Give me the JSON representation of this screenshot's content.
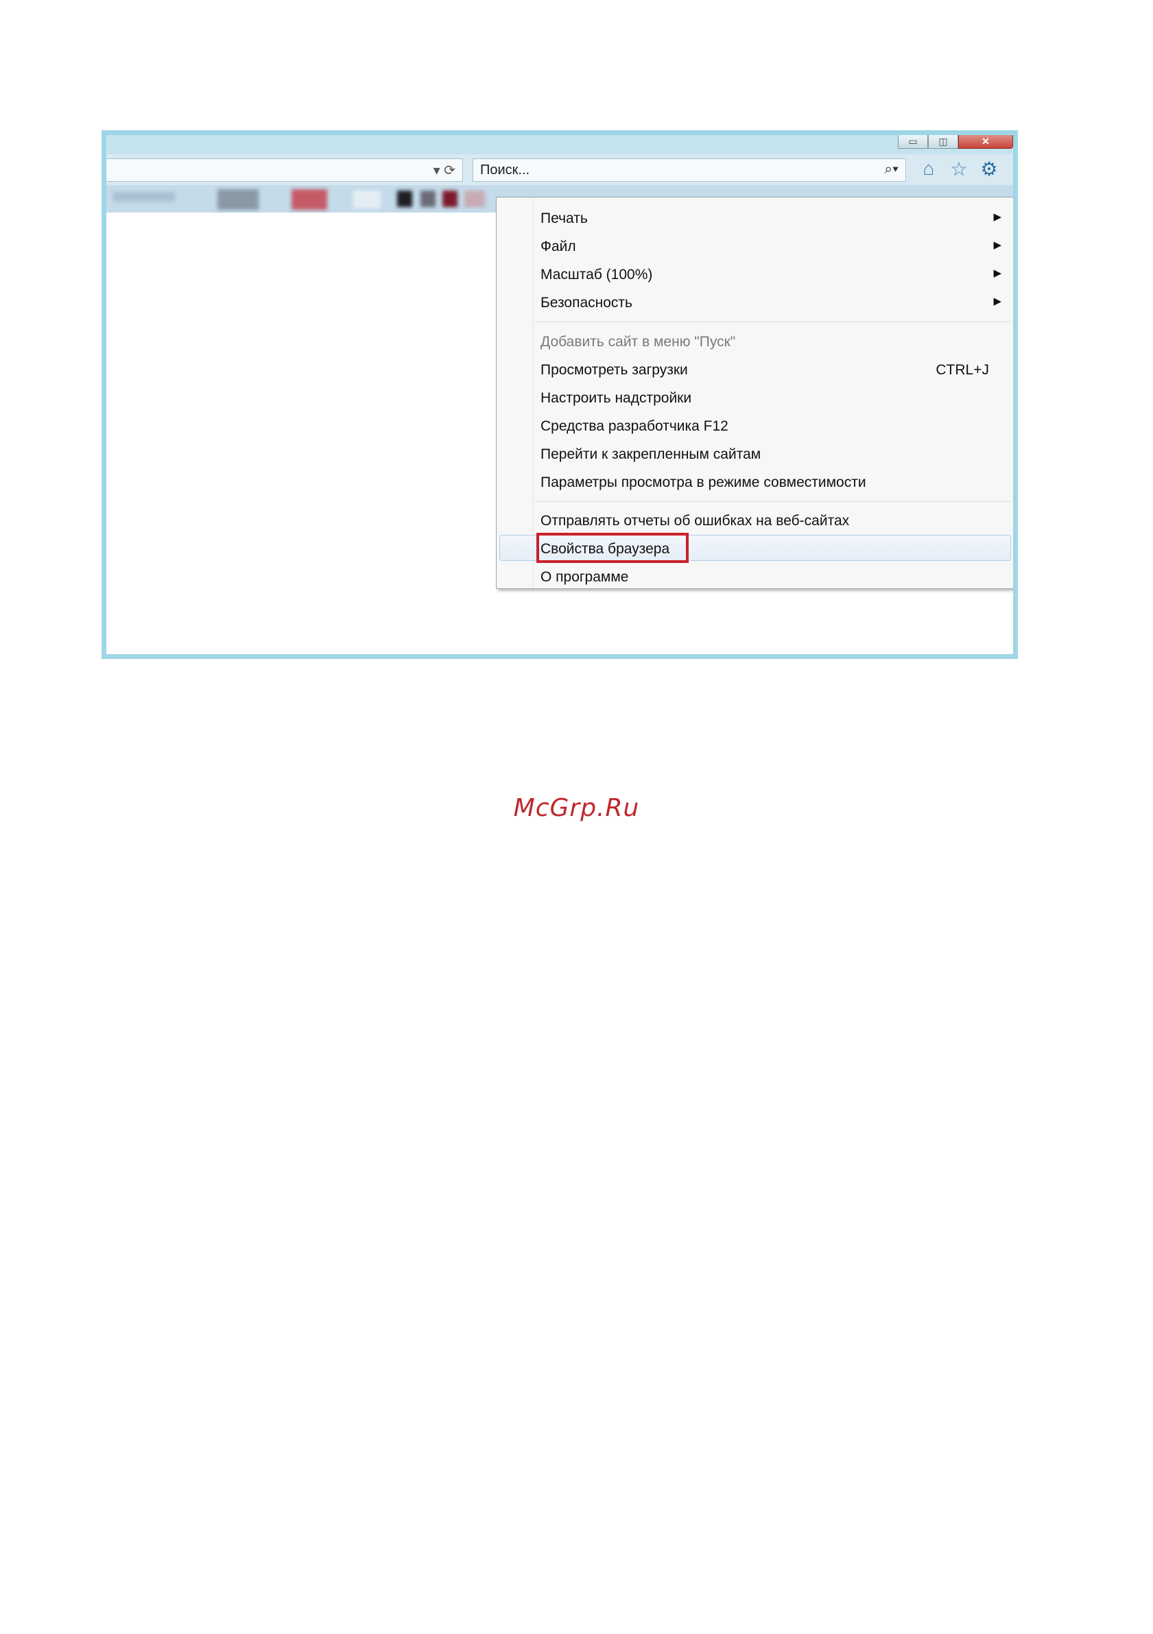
{
  "search": {
    "placeholder": "Поиск..."
  },
  "window_controls": {
    "minimize": "▭",
    "maximize": "◫",
    "close": "✕"
  },
  "address_bar": {
    "controls": "▾ ⟳"
  },
  "toolbar_icons": {
    "home": "⌂",
    "favorites": "☆",
    "tools": "⚙"
  },
  "search_icon": "⌕▾",
  "menu": {
    "group1": [
      {
        "label": "Печать",
        "submenu": true
      },
      {
        "label": "Файл",
        "submenu": true
      },
      {
        "label": "Масштаб (100%)",
        "submenu": true
      },
      {
        "label": "Безопасность",
        "submenu": true
      }
    ],
    "group2": [
      {
        "label": "Добавить сайт в меню \"Пуск\"",
        "disabled": true
      },
      {
        "label": "Просмотреть загрузки",
        "shortcut": "CTRL+J"
      },
      {
        "label": "Настроить надстройки"
      },
      {
        "label": "Средства разработчика F12"
      },
      {
        "label": "Перейти к закрепленным сайтам"
      },
      {
        "label": "Параметры просмотра в режиме совместимости"
      }
    ],
    "group3": [
      {
        "label": "Отправлять отчеты об ошибках на веб-сайтах"
      },
      {
        "label": "Свойства браузера",
        "highlighted": true
      },
      {
        "label": "О программе"
      }
    ],
    "submenu_arrow": "▶"
  },
  "watermark": "McGrp.Ru",
  "colors": {
    "frame": "#9dd6e6",
    "highlight_box": "#c9202b",
    "watermark": "#c0272d"
  }
}
